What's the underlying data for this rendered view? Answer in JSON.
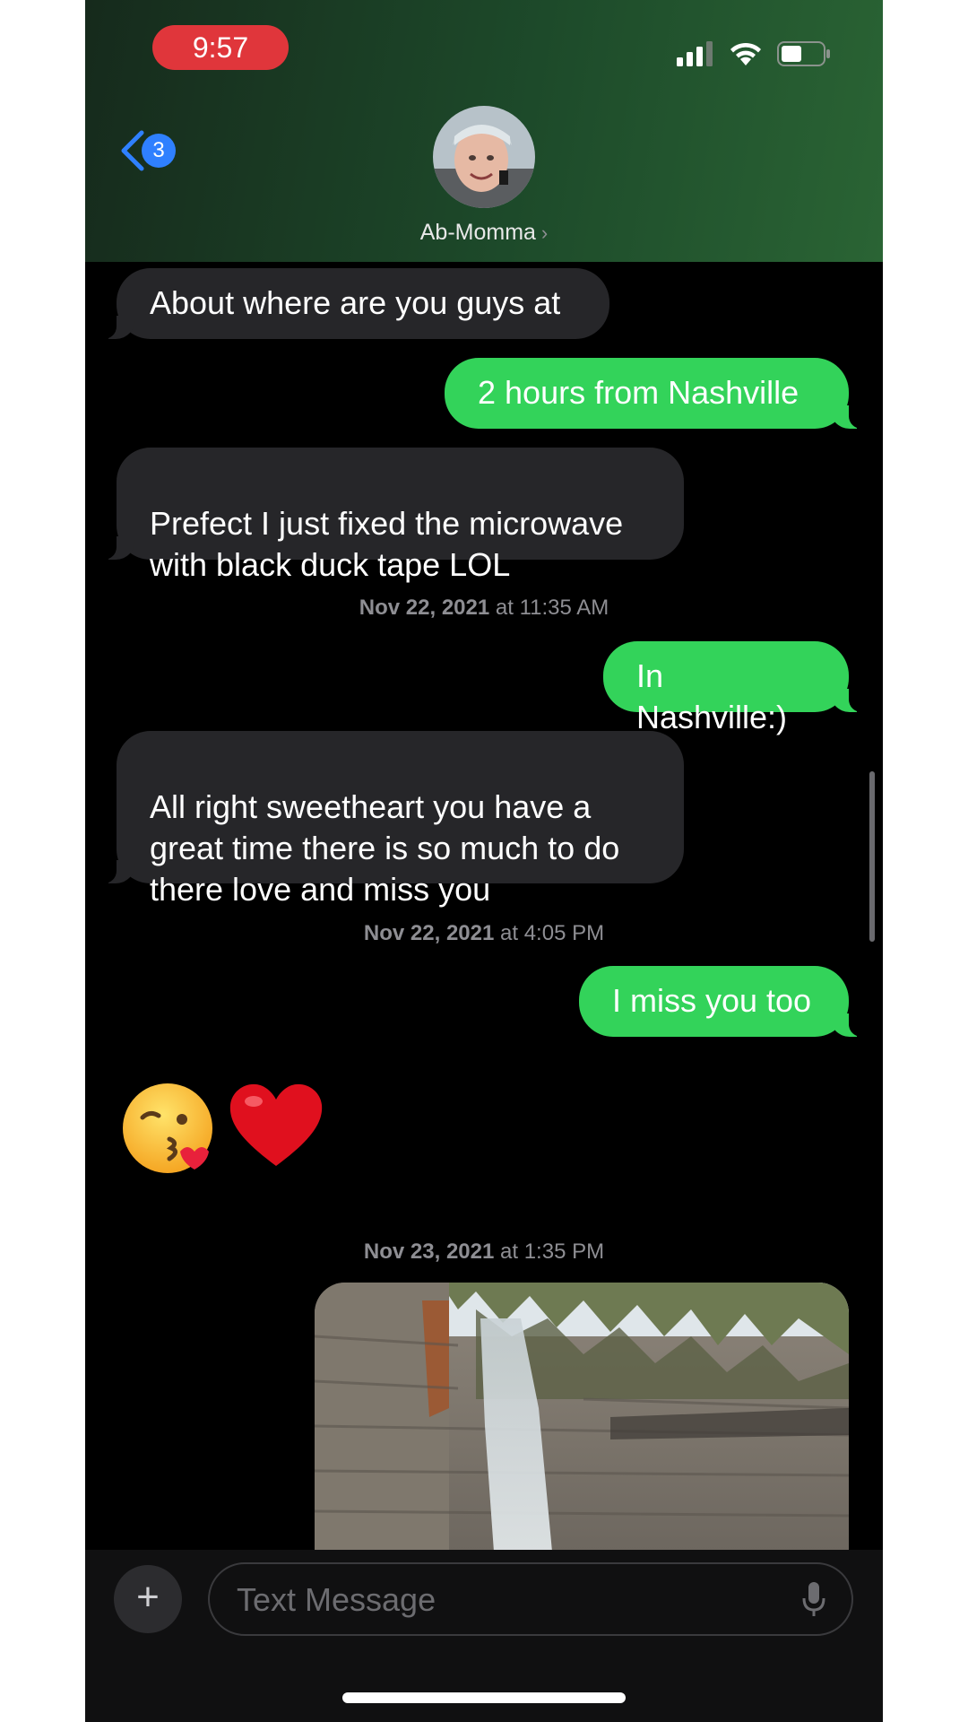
{
  "status_bar": {
    "time": "9:57"
  },
  "header": {
    "back_badge": "3",
    "contact_name": "Ab-Momma"
  },
  "messages": [
    {
      "direction": "in",
      "text": "About where are you guys at"
    },
    {
      "direction": "out",
      "text": "2 hours from Nashville"
    },
    {
      "direction": "in",
      "text": "Prefect I just fixed the microwave\nwith black duck tape  LOL"
    },
    {
      "direction": "out",
      "text": "In Nashville:)"
    },
    {
      "direction": "in",
      "text": "All right sweetheart you have a\ngreat time there is so much to do\nthere love and miss you"
    },
    {
      "direction": "out",
      "text": "I miss you too"
    },
    {
      "direction": "in",
      "text": "😘❤️"
    }
  ],
  "timestamps": [
    {
      "date": "Nov 22, 2021",
      "time": "at 11:35 AM"
    },
    {
      "date": "Nov 22, 2021",
      "time": "at 4:05 PM"
    },
    {
      "date": "Nov 23, 2021",
      "time": "at 1:35 PM"
    }
  ],
  "composer": {
    "placeholder": "Text Message"
  },
  "colors": {
    "outgoing": "#33d35a",
    "incoming": "#262629",
    "time_pill": "#e0363b",
    "badge": "#2f80ff"
  }
}
